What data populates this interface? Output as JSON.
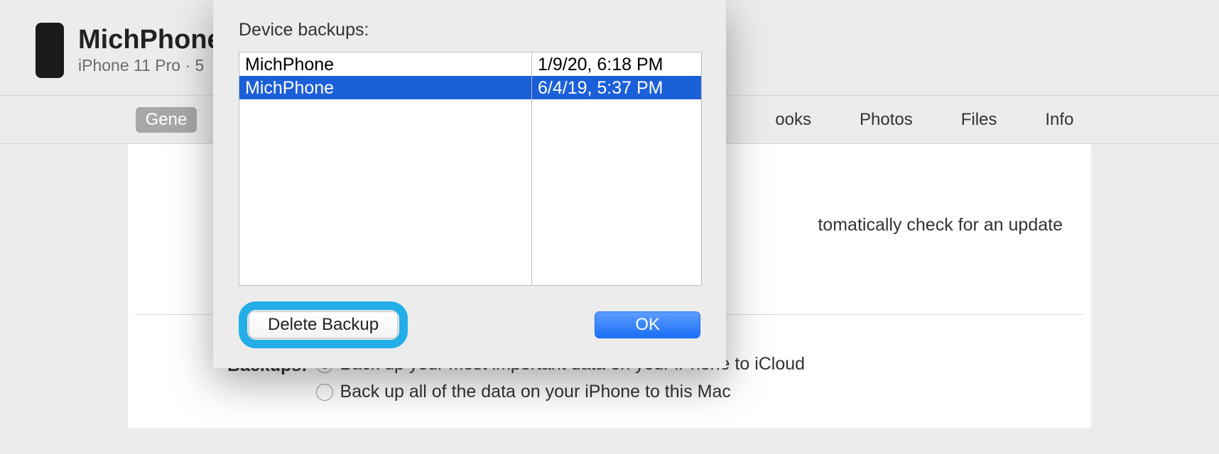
{
  "header": {
    "device_name": "MichPhone",
    "device_subtitle": "iPhone 11 Pro · 5"
  },
  "tabs": {
    "general": "Gene",
    "books": "ooks",
    "photos": "Photos",
    "files": "Files",
    "info": "Info"
  },
  "content": {
    "update_text": "tomatically check for an update"
  },
  "backups": {
    "label": "Backups:",
    "option1": "Back up your most important data on your iPhone to iCloud",
    "option2": "Back up all of the data on your iPhone to this Mac"
  },
  "modal": {
    "title": "Device backups:",
    "rows": [
      {
        "name": "MichPhone",
        "date": "1/9/20, 6:18 PM"
      },
      {
        "name": "MichPhone",
        "date": "6/4/19, 5:37 PM"
      }
    ],
    "delete_label": "Delete Backup",
    "ok_label": "OK"
  }
}
